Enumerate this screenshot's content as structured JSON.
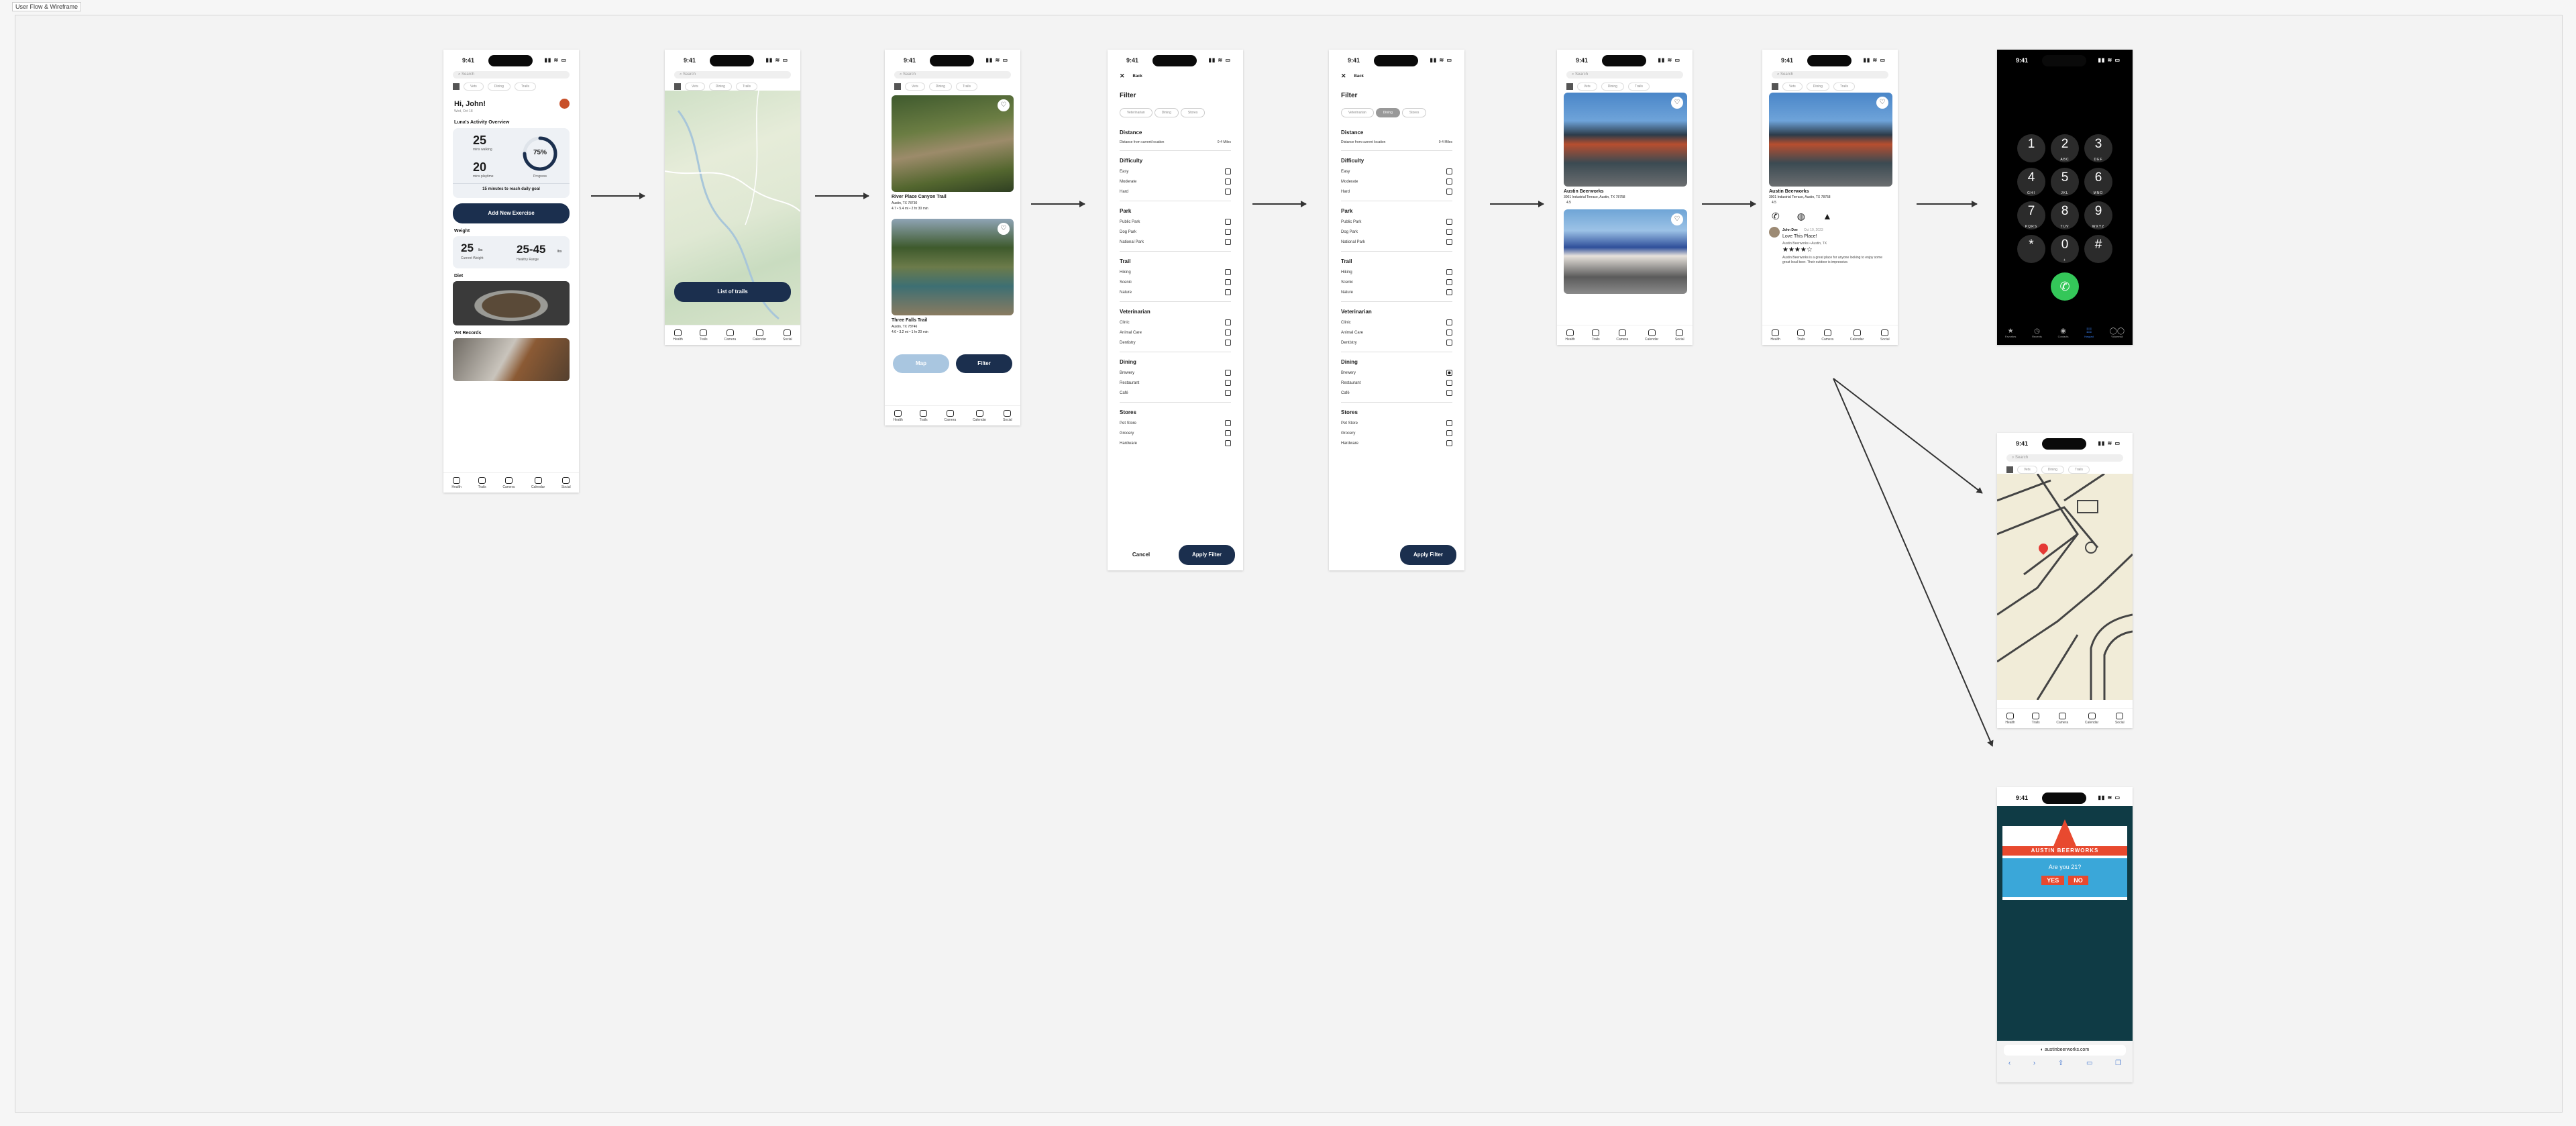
{
  "canvas_label": "User Flow & Wireframe",
  "status_time": "9:41",
  "search_placeholder": "Search",
  "chips": [
    "Vets",
    "Dining",
    "Trails"
  ],
  "nav": [
    "Health",
    "Trails",
    "Camera",
    "Calendar",
    "Social"
  ],
  "home": {
    "greeting": "Hi, John!",
    "date": "Wed, Oct 18",
    "overview_title": "Luna's Activity Overview",
    "walking_value": "25",
    "walking_label": "mins walking",
    "playtime_value": "20",
    "playtime_label": "mins playtime",
    "progress": "75%",
    "progress_label": "Progress",
    "progress_fraction": 0.75,
    "goal_text": "15 minutes to reach daily goal",
    "add_button": "Add New Exercise",
    "weight_title": "Weight",
    "current_weight": "25",
    "weight_unit": "lbs",
    "current_weight_label": "Current Weight",
    "healthy_range": "25-45",
    "healthy_range_label": "Healthy Range",
    "diet_title": "Diet",
    "vet_title": "Vet Records"
  },
  "map": {
    "list_button": "List of trails"
  },
  "trails": {
    "trail1_name": "River Place Canyon Trail",
    "trail1_location": "Austin, TX 78730",
    "trail1_meta": "4.7 • 5.4 mi • 2 hr 30 min",
    "trail2_name": "Three Falls Trail",
    "trail2_location": "Austin, TX 78746",
    "trail2_meta": "4.6 • 3.2 mi • 1 hr 20 min",
    "map_button": "Map",
    "filter_button": "Filter"
  },
  "filter": {
    "back": "Back",
    "title": "Filter",
    "tabs": [
      "Veterinarian",
      "Dining",
      "Stores"
    ],
    "distance_title": "Distance",
    "distance_label": "Distance from current location",
    "distance_value": "0-4 Miles",
    "sections": [
      {
        "title": "Difficulty",
        "options": [
          "Easy",
          "Moderate",
          "Hard"
        ]
      },
      {
        "title": "Park",
        "options": [
          "Public Park",
          "Dog Park",
          "National Park"
        ]
      },
      {
        "title": "Trail",
        "options": [
          "Hiking",
          "Scenic",
          "Nature"
        ]
      },
      {
        "title": "Veterinarian",
        "options": [
          "Clinic",
          "Animal Care",
          "Dentistry"
        ]
      },
      {
        "title": "Dining",
        "options": [
          "Brewery",
          "Restaurant",
          "Café"
        ]
      },
      {
        "title": "Stores",
        "options": [
          "Pet Store",
          "Grocery",
          "Hardware"
        ]
      }
    ],
    "cancel": "Cancel",
    "apply": "Apply Filter",
    "selected_option": "Brewery"
  },
  "venue": {
    "name": "Austin Beerworks",
    "address": "3001 Industrial Terrace, Austin, TX 78758",
    "rating": "4.5",
    "review_user": "John Doe",
    "review_date": "Oct 10, 2023",
    "review_title": "Love This Place!",
    "review_sub": "Austin Beerworks • Austin, TX",
    "review_text": "Austin Beerworks is a great place for anyone looking to enjoy some great local beer. Their outdoor is impressive."
  },
  "dialer": {
    "keys": [
      {
        "n": "1",
        "l": ""
      },
      {
        "n": "2",
        "l": "ABC"
      },
      {
        "n": "3",
        "l": "DEF"
      },
      {
        "n": "4",
        "l": "GHI"
      },
      {
        "n": "5",
        "l": "JKL"
      },
      {
        "n": "6",
        "l": "MNO"
      },
      {
        "n": "7",
        "l": "PQRS"
      },
      {
        "n": "8",
        "l": "TUV"
      },
      {
        "n": "9",
        "l": "WXYZ"
      },
      {
        "n": "*",
        "l": ""
      },
      {
        "n": "0",
        "l": "+"
      },
      {
        "n": "#",
        "l": ""
      }
    ],
    "tabs": [
      "Favorites",
      "Recents",
      "Contacts",
      "Keypad",
      "Voicemail"
    ]
  },
  "website": {
    "brand": "AUSTIN BEERWORKS",
    "question": "Are you 21?",
    "yes": "YES",
    "no": "NO",
    "url": "austinbeerworks.com"
  },
  "colors": {
    "accent": "#1b2f4e",
    "map_bg": "#f1ecd8",
    "call": "#34c759",
    "brand_red": "#e8492f",
    "brand_blue": "#3aa7d9"
  }
}
